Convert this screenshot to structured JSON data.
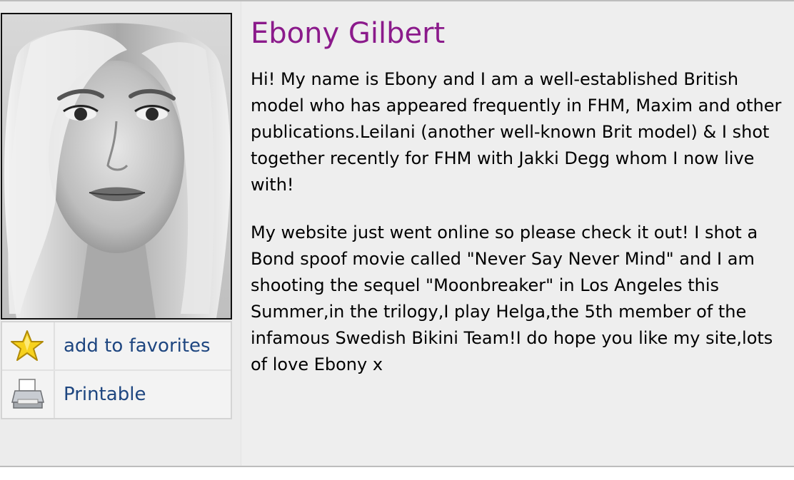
{
  "profile": {
    "name": "Ebony Gilbert",
    "bio": [
      "Hi! My name is Ebony and I am a well-established British model who has appeared frequently in FHM, Maxim and other publications.Leilani (another well-known Brit model) & I shot together recently for FHM with Jakki Degg whom I now live with!",
      "My website just went online so please check it out! I shot a Bond spoof movie called \"Never Say Never Mind\" and I am shooting the sequel \"Moonbreaker\" in Los Angeles this Summer,in the trilogy,I play Helga,the 5th member of the infamous Swedish Bikini Team!I do hope you like my site,lots of love Ebony x"
    ]
  },
  "actions": {
    "favorites": {
      "label": "add to favorites",
      "icon": "star-icon"
    },
    "printable": {
      "label": "Printable",
      "icon": "printer-icon"
    }
  },
  "colors": {
    "title": "#8b1a8b",
    "link": "#1e4680"
  }
}
